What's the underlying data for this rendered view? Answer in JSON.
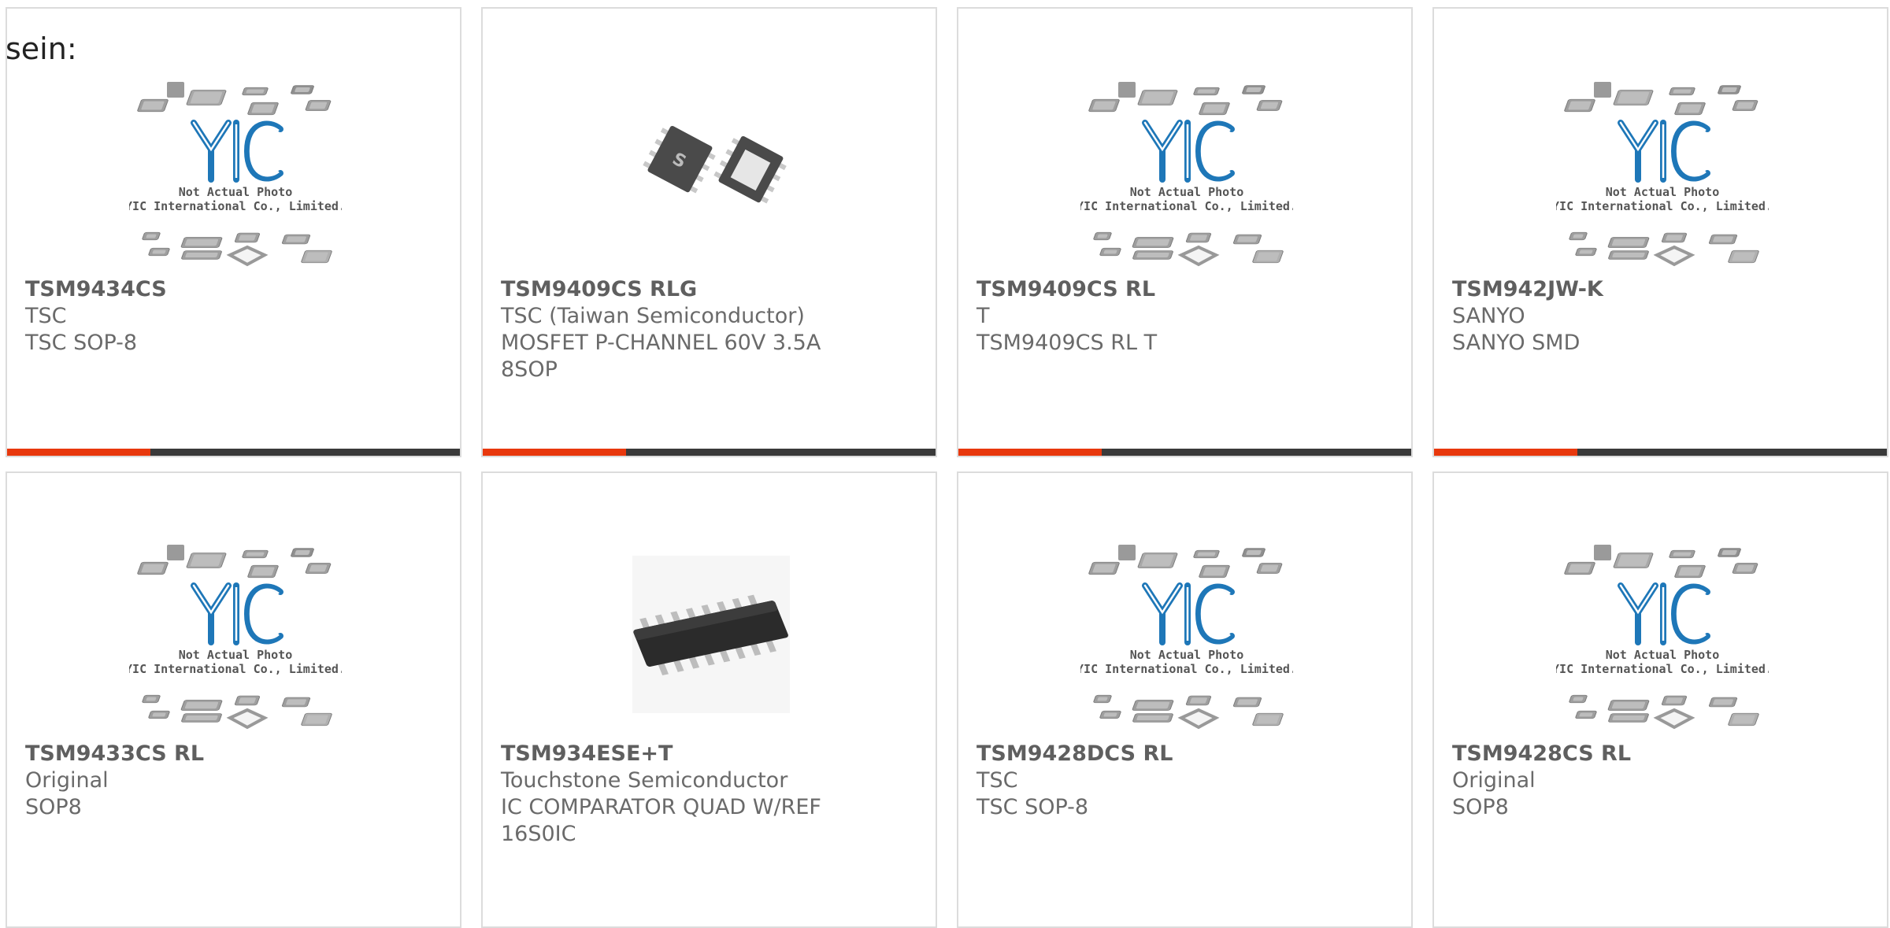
{
  "lead_text": "sein:",
  "placeholder": {
    "line1": "Not Actual Photo",
    "line2": "YIC International Co., Limited.",
    "logo": "YIC"
  },
  "colors": {
    "accent": "#e8380d",
    "bar": "#3a3a3a",
    "logo": "#1e77b8",
    "border": "#dcdcdc"
  },
  "cards": [
    {
      "part": "TSM9434CS",
      "maker": "TSC",
      "desc": "TSC SOP-8",
      "image": "yic-placeholder"
    },
    {
      "part": "TSM9409CS RLG",
      "maker": "TSC (Taiwan Semiconductor)",
      "desc": "MOSFET P-CHANNEL 60V 3.5A 8SOP",
      "image": "sop8-photo"
    },
    {
      "part": "TSM9409CS RL",
      "maker": "T",
      "desc": "TSM9409CS RL T",
      "image": "yic-placeholder"
    },
    {
      "part": "TSM942JW-K",
      "maker": "SANYO",
      "desc": "SANYO SMD",
      "image": "yic-placeholder"
    },
    {
      "part": "TSM9433CS RL",
      "maker": "Original",
      "desc": "SOP8",
      "image": "yic-placeholder"
    },
    {
      "part": "TSM934ESE+T",
      "maker": "Touchstone Semiconductor",
      "desc": "IC COMPARATOR QUAD W/REF 16S0IC",
      "image": "soic16-photo"
    },
    {
      "part": "TSM9428DCS RL",
      "maker": "TSC",
      "desc": "TSC SOP-8",
      "image": "yic-placeholder"
    },
    {
      "part": "TSM9428CS RL",
      "maker": "Original",
      "desc": "SOP8",
      "image": "yic-placeholder"
    }
  ]
}
